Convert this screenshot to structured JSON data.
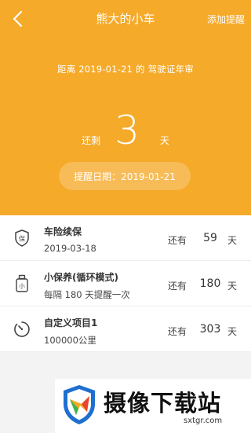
{
  "header": {
    "title": "熊大的小车",
    "action_label": "添加提醒"
  },
  "hero": {
    "distance_text": "距离 2019-01-21 的 驾驶证年审",
    "remaining_prefix": "还剩",
    "remaining_days": "3",
    "remaining_suffix": "天",
    "remind_date": "提醒日期：2019-01-21"
  },
  "colors": {
    "accent": "#f5aa2a"
  },
  "items": [
    {
      "icon": "insurance-shield-icon",
      "title": "车险续保",
      "subtitle": "2019-03-18",
      "left_label": "还有",
      "count": "59",
      "unit": "天"
    },
    {
      "icon": "maintenance-bottle-icon",
      "title": "小保养(循环模式)",
      "subtitle": "每隔 180 天提醒一次",
      "left_label": "还有",
      "count": "180",
      "unit": "天"
    },
    {
      "icon": "custom-timer-icon",
      "title": "自定义项目1",
      "subtitle": "100000公里",
      "left_label": "还有",
      "count": "303",
      "unit": "天"
    }
  ],
  "watermark": {
    "title": "摄像下载站",
    "url": "sxtgr.com"
  }
}
